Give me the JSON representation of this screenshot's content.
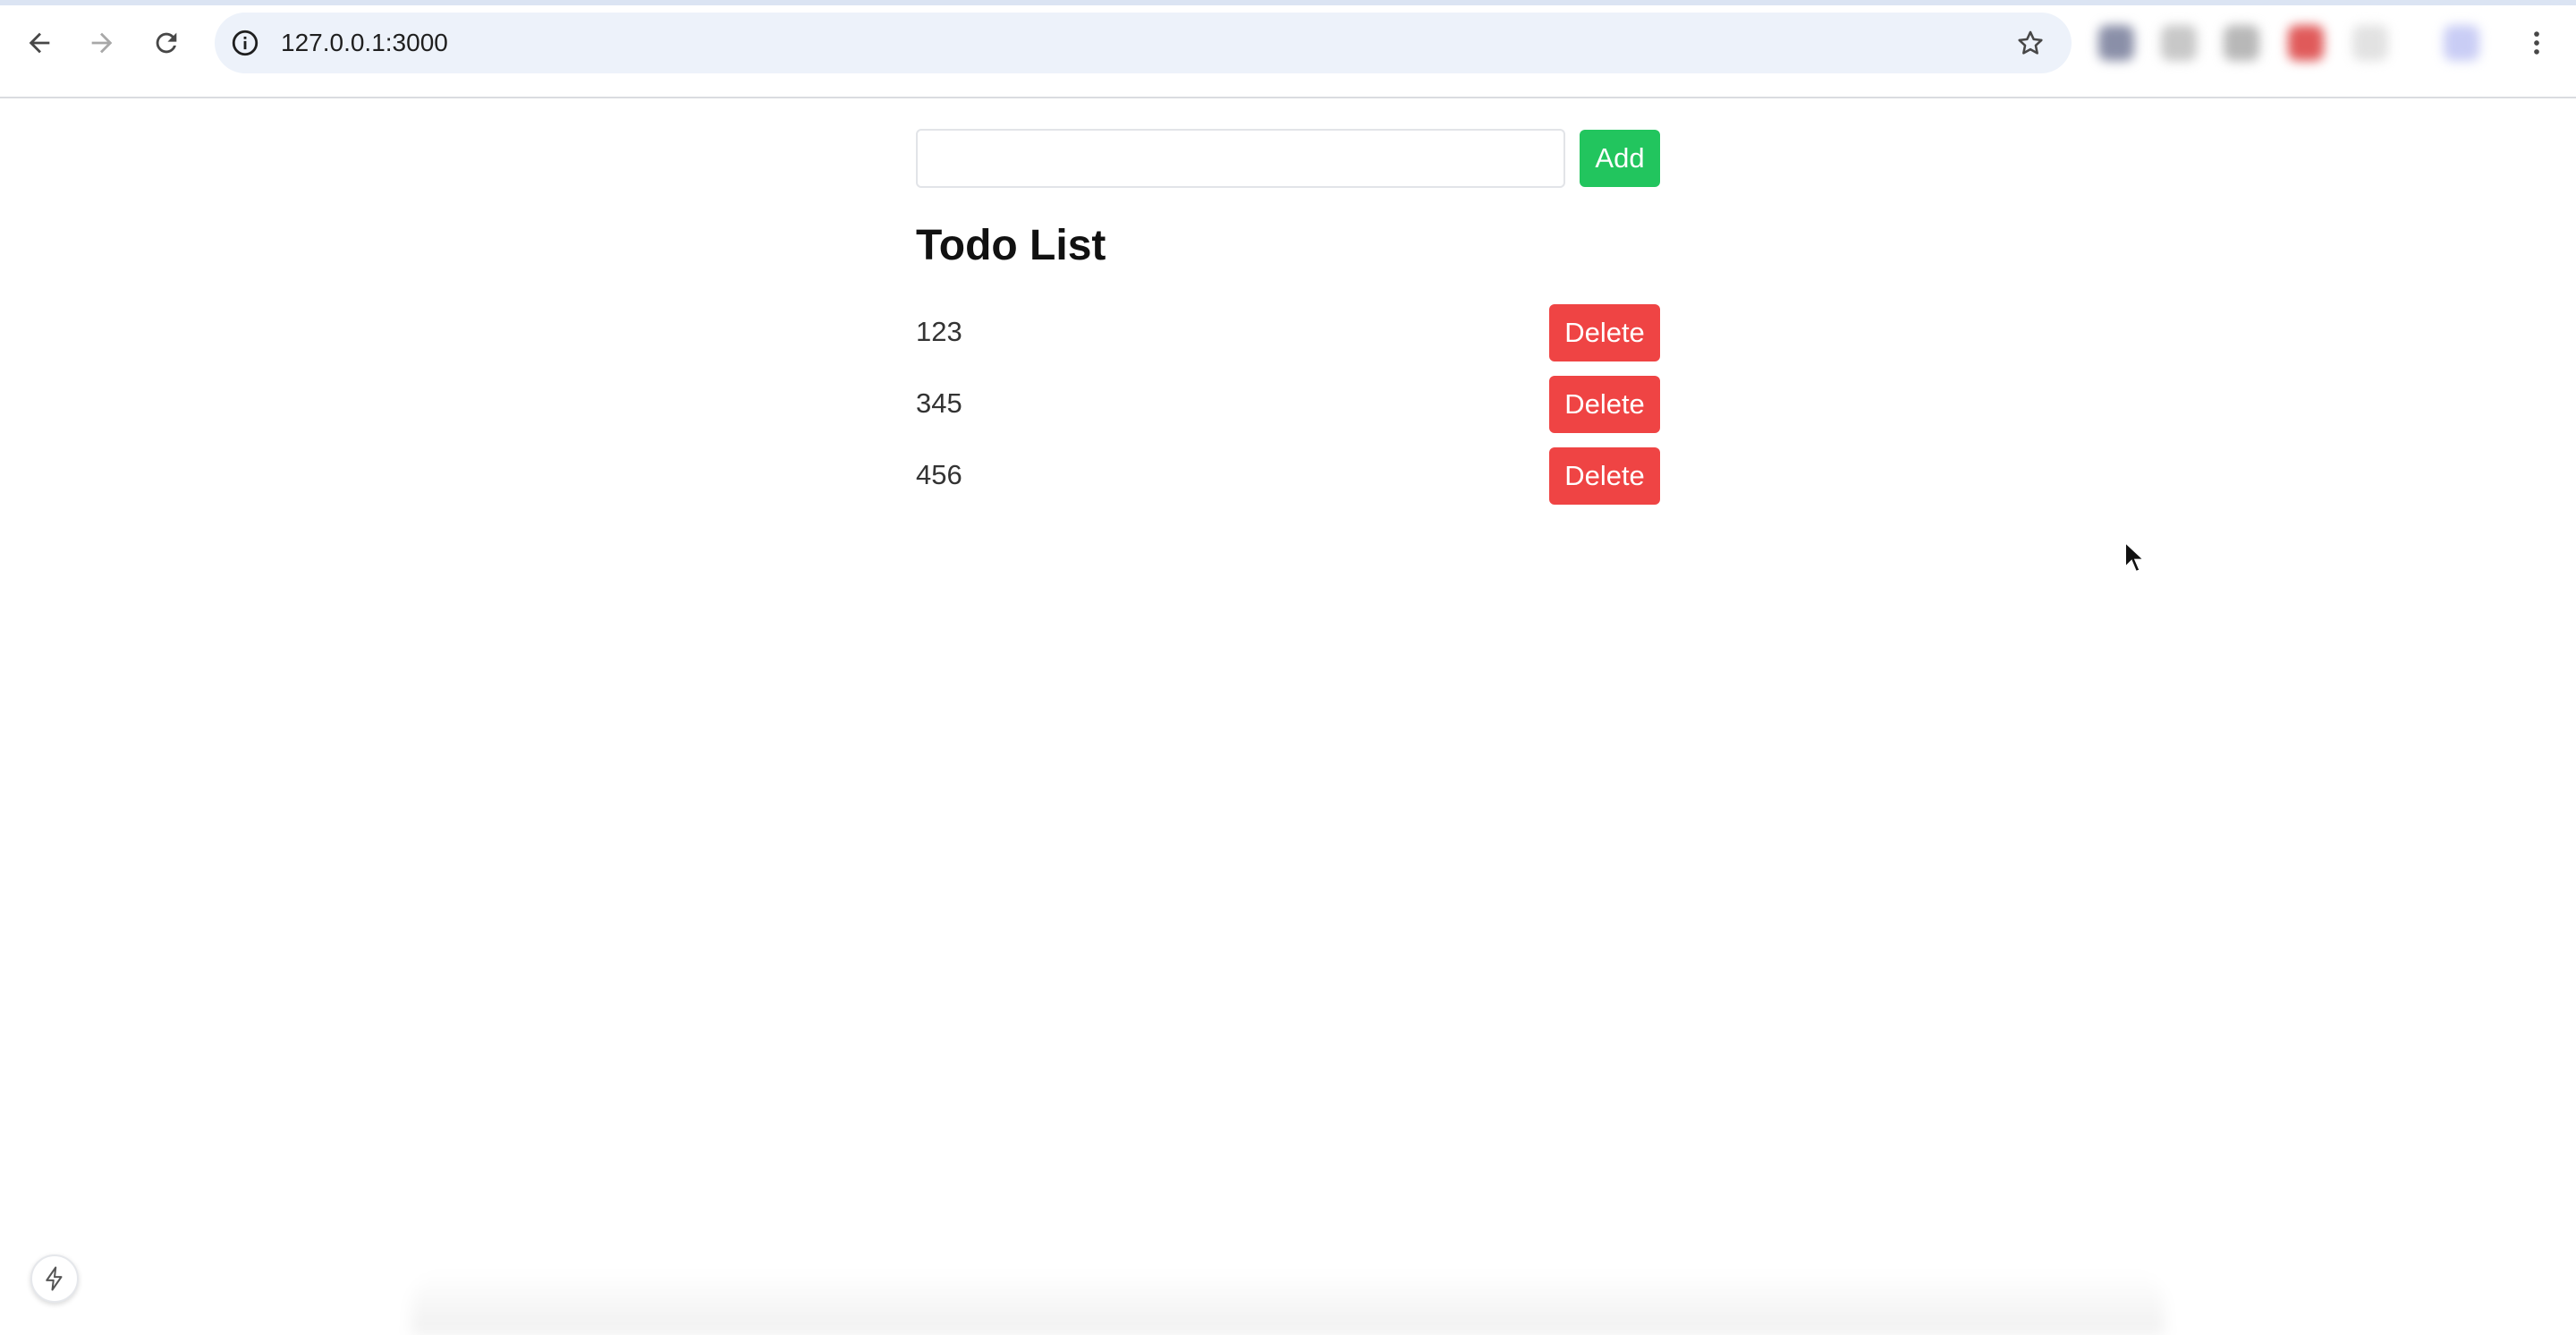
{
  "browser": {
    "url": "127.0.0.1:3000",
    "icons": {
      "back": "arrow-left-icon",
      "forward": "arrow-right-icon",
      "reload": "reload-icon",
      "site_info": "info-icon",
      "bookmark": "star-icon",
      "menu": "kebab-menu-icon"
    }
  },
  "form": {
    "input_value": "",
    "input_placeholder": "",
    "add_label": "Add"
  },
  "heading": "Todo List",
  "todos": [
    {
      "text": "123",
      "delete_label": "Delete"
    },
    {
      "text": "345",
      "delete_label": "Delete"
    },
    {
      "text": "456",
      "delete_label": "Delete"
    }
  ],
  "colors": {
    "add_button": "#22c55e",
    "delete_button": "#ef4444",
    "omnibox": "#edf2fa"
  }
}
